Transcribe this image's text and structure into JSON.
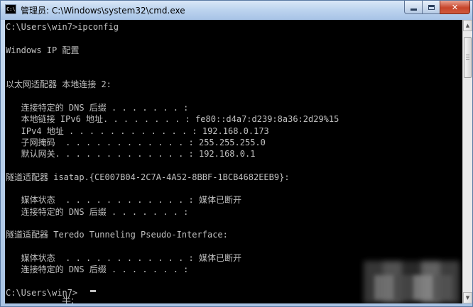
{
  "window": {
    "title": "管理员: C:\\Windows\\system32\\cmd.exe",
    "icon_text": "C:\\"
  },
  "console": {
    "lines": [
      "C:\\Users\\win7>ipconfig",
      "",
      "Windows IP 配置",
      "",
      "",
      "以太网适配器 本地连接 2:",
      "",
      "   连接特定的 DNS 后缀 . . . . . . . :",
      "   本地链接 IPv6 地址. . . . . . . . : fe80::d4a7:d239:8a36:2d29%15",
      "   IPv4 地址 . . . . . . . . . . . . : 192.168.0.173",
      "   子网掩码  . . . . . . . . . . . . : 255.255.255.0",
      "   默认网关. . . . . . . . . . . . . : 192.168.0.1",
      "",
      "隧道适配器 isatap.{CE007B04-2C7A-4A52-8BBF-1BCB4682EEB9}:",
      "",
      "   媒体状态  . . . . . . . . . . . . : 媒体已断开",
      "   连接特定的 DNS 后缀 . . . . . . . :",
      "",
      "隧道适配器 Teredo Tunneling Pseudo-Interface:",
      "",
      "   媒体状态  . . . . . . . . . . . . : 媒体已断开",
      "   连接特定的 DNS 后缀 . . . . . . . :",
      "",
      "C:\\Users\\win7>"
    ],
    "ime_indicator": "半:"
  },
  "icons": {
    "app": "cmd-icon",
    "minimize": "minimize-icon",
    "maximize": "maximize-icon",
    "close": "close-icon"
  },
  "colors": {
    "console_bg": "#000000",
    "console_text": "#c0c0c0",
    "close_button": "#c7452a"
  }
}
